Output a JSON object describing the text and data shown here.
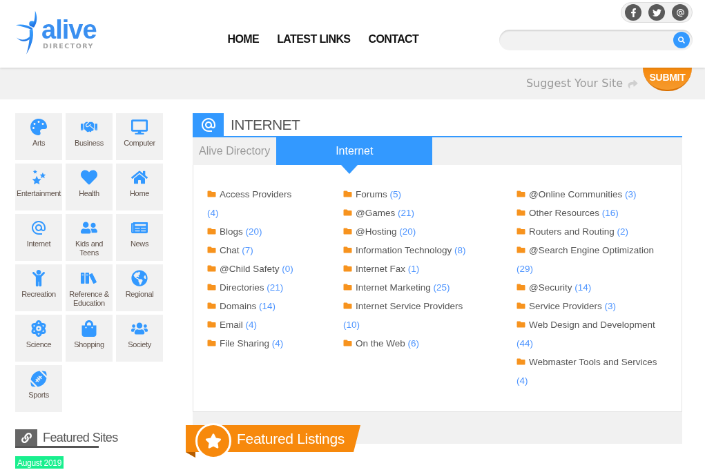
{
  "logo": {
    "wordmark": "alive",
    "tagline": "DIRECTORY"
  },
  "nav": [
    "HOME",
    "LATEST LINKS",
    "CONTACT"
  ],
  "suggest": {
    "label": "Suggest Your Site",
    "button": "SUBMIT"
  },
  "categories": [
    "Arts",
    "Business",
    "Computer",
    "Entertainment",
    "Health",
    "Home",
    "Internet",
    "Kids and Teens",
    "News",
    "Recreation",
    "Reference & Education",
    "Regional",
    "Science",
    "Shopping",
    "Society",
    "Sports"
  ],
  "featured_sites": {
    "title": "Featured Sites",
    "date": "August 2019"
  },
  "section": {
    "title": "INTERNET",
    "tabs": [
      {
        "label": "Alive Directory",
        "selected": false
      },
      {
        "label": "Internet",
        "selected": true
      }
    ],
    "columns": [
      [
        {
          "name": "Access Providers",
          "count": "(4)"
        },
        {
          "name": "Blogs",
          "count": "(20)"
        },
        {
          "name": "Chat",
          "count": "(7)"
        },
        {
          "name": "@Child Safety",
          "count": "(0)"
        },
        {
          "name": "Directories",
          "count": "(21)"
        },
        {
          "name": "Domains",
          "count": "(14)"
        },
        {
          "name": "Email",
          "count": "(4)"
        },
        {
          "name": "File Sharing",
          "count": "(4)"
        }
      ],
      [
        {
          "name": "Forums",
          "count": "(5)"
        },
        {
          "name": "@Games",
          "count": "(21)"
        },
        {
          "name": "@Hosting",
          "count": "(20)"
        },
        {
          "name": "Information Technology",
          "count": "(8)"
        },
        {
          "name": "Internet Fax",
          "count": "(1)"
        },
        {
          "name": "Internet Marketing",
          "count": "(25)"
        },
        {
          "name": "Internet Service Providers",
          "count": "(10)"
        },
        {
          "name": "On the Web",
          "count": "(6)"
        }
      ],
      [
        {
          "name": "@Online Communities",
          "count": "(3)"
        },
        {
          "name": "Other Resources",
          "count": "(16)"
        },
        {
          "name": "Routers and Routing",
          "count": "(2)"
        },
        {
          "name": "@Search Engine Optimization",
          "count": "(29)"
        },
        {
          "name": "@Security",
          "count": "(14)"
        },
        {
          "name": "Service Providers",
          "count": "(3)"
        },
        {
          "name": "Web Design and Development",
          "count": "(44)"
        },
        {
          "name": "Webmaster Tools and Services",
          "count": "(4)"
        }
      ]
    ]
  },
  "featured_listings": {
    "title": "Featured Listings"
  }
}
